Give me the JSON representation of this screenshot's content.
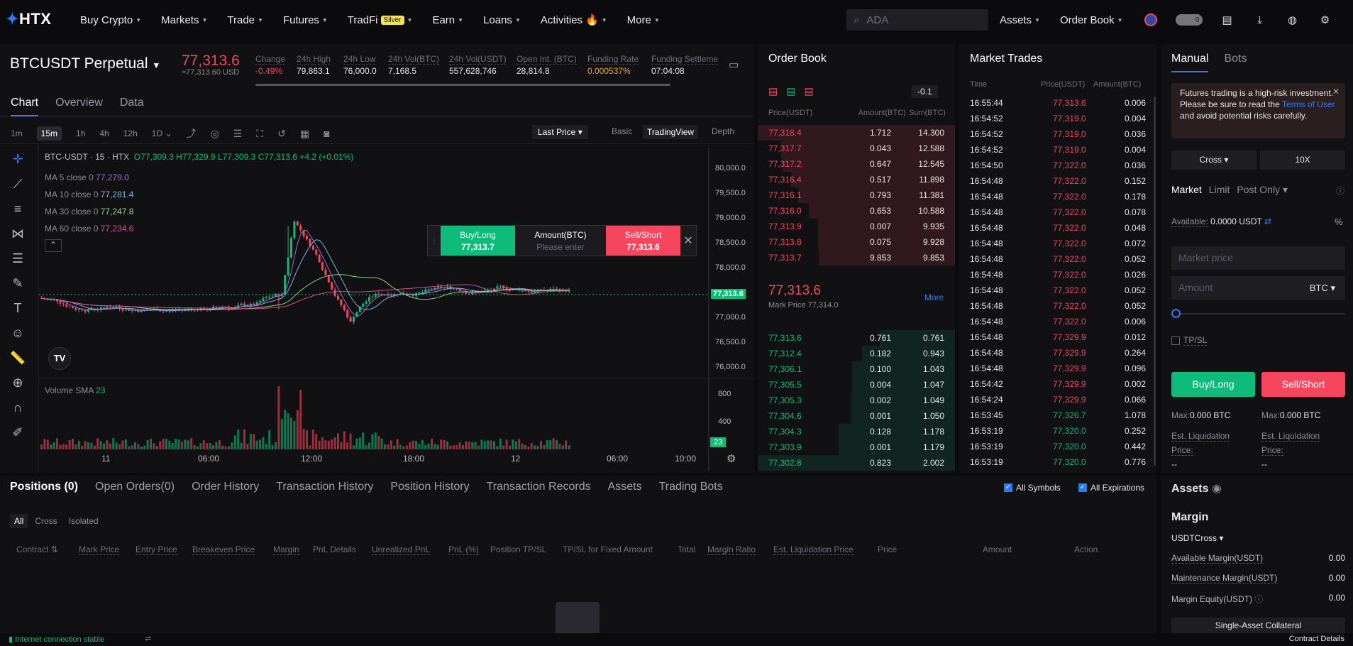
{
  "nav": {
    "logo": "HTX",
    "items": [
      {
        "label": "Buy Crypto"
      },
      {
        "label": "Markets"
      },
      {
        "label": "Trade"
      },
      {
        "label": "Futures"
      },
      {
        "label": "TradFi",
        "badge": "Silver"
      },
      {
        "label": "Earn"
      },
      {
        "label": "Loans"
      },
      {
        "label": "Activities"
      },
      {
        "label": "More"
      }
    ],
    "search_placeholder": "ADA",
    "right_items": [
      {
        "label": "Assets"
      },
      {
        "label": "Order Book"
      }
    ],
    "toggle_value": "0"
  },
  "ticker": {
    "symbol": "BTCUSDT Perpetual",
    "last_price": "77,313.6",
    "last_price_usd": "≈77,313.60 USD",
    "stats": [
      {
        "label": "Change",
        "value": "-0.49%",
        "color": "#f6465d"
      },
      {
        "label": "24h High",
        "value": "79,863.1"
      },
      {
        "label": "24h Low",
        "value": "76,000.0"
      },
      {
        "label": "24h Vol(BTC)",
        "value": "7,168.5"
      },
      {
        "label": "24h Vol(USDT)",
        "value": "557,628,746"
      },
      {
        "label": "Open Int. (BTC)",
        "value": "28,814.8"
      },
      {
        "label": "Funding Rate",
        "value": "0.000537%",
        "color": "#f6a623"
      },
      {
        "label": "Funding Settleme",
        "value": "07:04:08"
      }
    ]
  },
  "chart_tabs": [
    "Chart",
    "Overview",
    "Data"
  ],
  "timeframes": [
    "1m",
    "15m",
    "1h",
    "4h",
    "12h",
    "1D"
  ],
  "chart_mode": {
    "price_type": "Last Price",
    "basic": "Basic",
    "tv": "TradingView",
    "depth": "Depth"
  },
  "chart_legend": {
    "title": "BTC-USDT · 15 · HTX",
    "ohlc": "O77,309.3 H77,329.9 L77,309.3 C77,313.6 +4.2 (+0.01%)",
    "ma": [
      {
        "label": "MA 5 close 0",
        "value": "77,279.0",
        "color": "#a06ad8"
      },
      {
        "label": "MA 10 close 0",
        "value": "77,281.4",
        "color": "#7fb3e6"
      },
      {
        "label": "MA 30 close 0",
        "value": "77,247.8",
        "color": "#8bd87a"
      },
      {
        "label": "MA 60 close 0",
        "value": "77,234.6",
        "color": "#d64f9a"
      }
    ],
    "volume": "Volume SMA",
    "volume_value": "23"
  },
  "quick_trade": {
    "buy": "Buy/Long",
    "buy_price": "77,313.7",
    "amount": "Amount(BTC)",
    "amount_ph": "Please enter",
    "sell": "Sell/Short",
    "sell_price": "77,313.6"
  },
  "chart_data": {
    "type": "candlestick",
    "price_axis": [
      "80,000.0",
      "79,500.0",
      "79,000.0",
      "78,500.0",
      "78,000.0",
      "77,500.0",
      "77,000.0",
      "76,500.0",
      "76,000.0"
    ],
    "time_axis": [
      "11",
      "06:00",
      "12:00",
      "18:00",
      "12",
      "06:00",
      "10:00"
    ],
    "volume_axis": [
      "800",
      "400"
    ],
    "current_price_label": "77,313.6",
    "current_volume_label": "23"
  },
  "orderbook": {
    "title": "Order Book",
    "step": "0.1",
    "cols": [
      "Price(USDT)",
      "Amount(BTC)",
      "Sum(BTC)"
    ],
    "asks": [
      [
        "77,318.4",
        "1.712",
        "14.300"
      ],
      [
        "77,317.7",
        "0.043",
        "12.588"
      ],
      [
        "77,317.2",
        "0.647",
        "12.545"
      ],
      [
        "77,316.4",
        "0.517",
        "11.898"
      ],
      [
        "77,316.1",
        "0.793",
        "11.381"
      ],
      [
        "77,316.0",
        "0.653",
        "10.588"
      ],
      [
        "77,313.9",
        "0.007",
        "9.935"
      ],
      [
        "77,313.8",
        "0.075",
        "9.928"
      ],
      [
        "77,313.7",
        "9.853",
        "9.853"
      ]
    ],
    "mid_price": "77,313.6",
    "mark_price": "Mark Price 77,314.0",
    "more": "More",
    "bids": [
      [
        "77,313.6",
        "0.761",
        "0.761"
      ],
      [
        "77,312.4",
        "0.182",
        "0.943"
      ],
      [
        "77,306.1",
        "0.100",
        "1.043"
      ],
      [
        "77,305.5",
        "0.004",
        "1.047"
      ],
      [
        "77,305.3",
        "0.002",
        "1.049"
      ],
      [
        "77,304.6",
        "0.001",
        "1.050"
      ],
      [
        "77,304.3",
        "0.128",
        "1.178"
      ],
      [
        "77,303.9",
        "0.001",
        "1.179"
      ],
      [
        "77,302.8",
        "0.823",
        "2.002"
      ]
    ]
  },
  "trades": {
    "title": "Market Trades",
    "cols": [
      "Time",
      "Price(USDT)",
      "Amount(BTC)"
    ],
    "rows": [
      [
        "16:55:44",
        "77,313.6",
        "0.006",
        "r"
      ],
      [
        "16:54:52",
        "77,319.0",
        "0.004",
        "r"
      ],
      [
        "16:54:52",
        "77,319.0",
        "0.036",
        "r"
      ],
      [
        "16:54:52",
        "77,319.0",
        "0.004",
        "r"
      ],
      [
        "16:54:50",
        "77,322.0",
        "0.036",
        "r"
      ],
      [
        "16:54:48",
        "77,322.0",
        "0.152",
        "r"
      ],
      [
        "16:54:48",
        "77,322.0",
        "0.178",
        "r"
      ],
      [
        "16:54:48",
        "77,322.0",
        "0.078",
        "r"
      ],
      [
        "16:54:48",
        "77,322.0",
        "0.048",
        "r"
      ],
      [
        "16:54:48",
        "77,322.0",
        "0.072",
        "r"
      ],
      [
        "16:54:48",
        "77,322.0",
        "0.052",
        "r"
      ],
      [
        "16:54:48",
        "77,322.0",
        "0.026",
        "r"
      ],
      [
        "16:54:48",
        "77,322.0",
        "0.052",
        "r"
      ],
      [
        "16:54:48",
        "77,322.0",
        "0.052",
        "r"
      ],
      [
        "16:54:48",
        "77,322.0",
        "0.006",
        "r"
      ],
      [
        "16:54:48",
        "77,329.9",
        "0.012",
        "r"
      ],
      [
        "16:54:48",
        "77,329.9",
        "0.264",
        "r"
      ],
      [
        "16:54:48",
        "77,329.9",
        "0.096",
        "r"
      ],
      [
        "16:54:42",
        "77,329.9",
        "0.002",
        "r"
      ],
      [
        "16:54:24",
        "77,329.9",
        "0.066",
        "r"
      ],
      [
        "16:53:45",
        "77,326.7",
        "1.078",
        "g"
      ],
      [
        "16:53:19",
        "77,320.0",
        "0.252",
        "g"
      ],
      [
        "16:53:19",
        "77,320.0",
        "0.442",
        "g"
      ],
      [
        "16:53:19",
        "77,320.0",
        "0.776",
        "g"
      ]
    ]
  },
  "trade_panel": {
    "tabs": [
      "Manual",
      "Bots"
    ],
    "warning_pre": "Futures trading is a high-risk investment. Please be sure to read the ",
    "warning_link": "Terms of User",
    "warning_post": " and avoid potential risks carefully.",
    "margin_mode": "Cross",
    "leverage": "10X",
    "order_types": [
      "Market",
      "Limit",
      "Post Only"
    ],
    "available_label": "Available:",
    "available_value": "0.0000 USDT",
    "price_ph": "Market price",
    "amount_ph": "Amount",
    "amount_unit": "BTC",
    "tpsl": "TP/SL",
    "buy": "Buy/Long",
    "sell": "Sell/Short",
    "max_label": "Max:",
    "max_buy": "0.000 BTC",
    "max_sell": "0.000 BTC",
    "liq_label": "Est. Liquidation Price:",
    "liq_buy": "--",
    "liq_sell": "--"
  },
  "bottom": {
    "tabs": [
      "Positions (0)",
      "Open Orders(0)",
      "Order History",
      "Transaction History",
      "Position History",
      "Transaction Records",
      "Assets",
      "Trading Bots"
    ],
    "filters": [
      "All",
      "Cross",
      "Isolated"
    ],
    "all_symbols": "All Symbols",
    "all_expirations": "All Expirations",
    "cols": [
      "Contract",
      "Mark Price",
      "Entry Price",
      "Breakeven Price",
      "Margin",
      "PnL Details",
      "Unrealized PnL",
      "PnL (%)",
      "Position TP/SL",
      "TP/SL for Fixed Amount",
      "Total",
      "Margin Ratio",
      "Est. Liquidation Price",
      "Price",
      "Amount",
      "Action"
    ]
  },
  "assets": {
    "title": "Assets",
    "margin": "Margin",
    "mode": "USDTCross",
    "rows": [
      {
        "label": "Available Margin(USDT)",
        "value": "0.00"
      },
      {
        "label": "Maintenance Margin(USDT)",
        "value": "0.00"
      },
      {
        "label": "Margin Equity(USDT)",
        "value": "0.00"
      }
    ],
    "collateral": "Single-Asset Collateral"
  },
  "status": {
    "connection": "Internet connection stable",
    "contract_details": "Contract Details"
  }
}
